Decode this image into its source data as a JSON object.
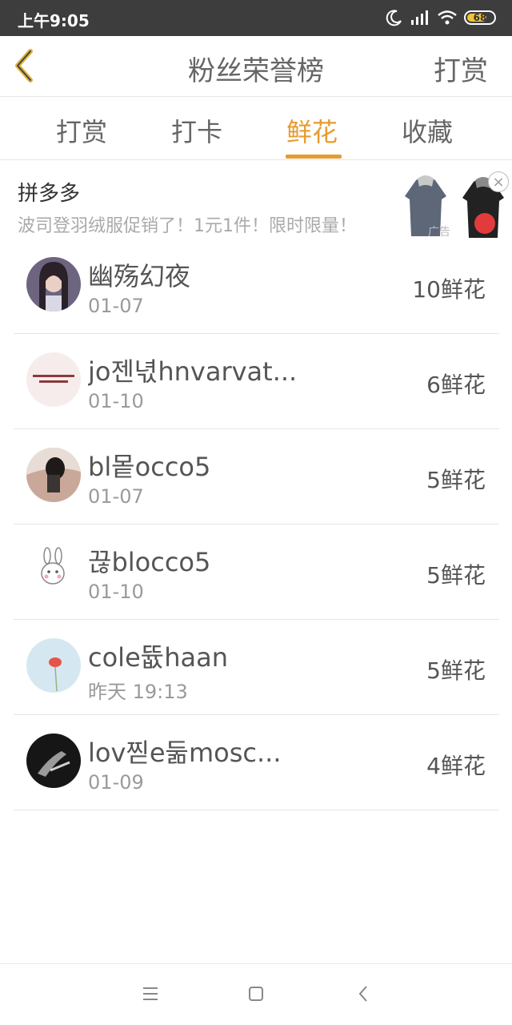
{
  "status_bar": {
    "time": "上午9:05",
    "battery": "68"
  },
  "header": {
    "title": "粉丝荣誉榜",
    "action": "打赏"
  },
  "tabs": [
    "打赏",
    "打卡",
    "鲜花",
    "收藏"
  ],
  "active_tab": "鲜花",
  "ad": {
    "brand": "拼多多",
    "text": "波司登羽绒服促销了！1元1件！限时限量！",
    "label": "广告"
  },
  "fans": [
    {
      "name": "幽殇幻夜",
      "date": "01-07",
      "count": "10鲜花"
    },
    {
      "name": "jo젠녃hnvarvat...",
      "date": "01-10",
      "count": "6鲜花"
    },
    {
      "name": "bl뫁occo5",
      "date": "01-07",
      "count": "5鲜花"
    },
    {
      "name": "끊blocco5",
      "date": "01-10",
      "count": "5鲜花"
    },
    {
      "name": "cole뜞haan",
      "date": "昨天 19:13",
      "count": "5鲜花"
    },
    {
      "name": "lov찓e둚mosc...",
      "date": "01-09",
      "count": "4鲜花"
    }
  ],
  "colors": {
    "accent": "#e79b2e",
    "status_bar": "#3d3d3d"
  }
}
